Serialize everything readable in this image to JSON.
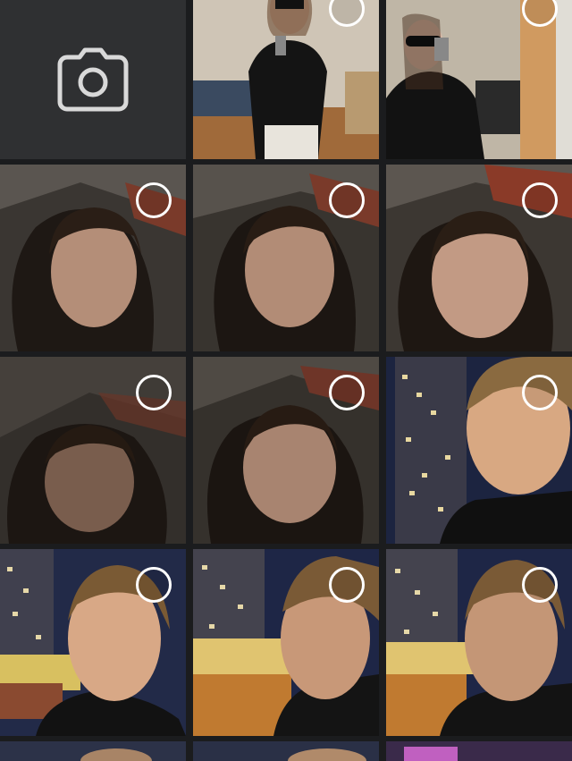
{
  "picker": {
    "camera_tile": {
      "icon": "camera-icon"
    },
    "photos": [
      {
        "id": 1,
        "scene": "mirror-selfie-sunglasses-room",
        "selected": false
      },
      {
        "id": 2,
        "scene": "mirror-selfie-sunglasses-hallway",
        "selected": false
      },
      {
        "id": 3,
        "scene": "night-selfie-graffiti-wall",
        "selected": false
      },
      {
        "id": 4,
        "scene": "night-selfie-graffiti-wall",
        "selected": false
      },
      {
        "id": 5,
        "scene": "night-selfie-graffiti-wall",
        "selected": false
      },
      {
        "id": 6,
        "scene": "night-selfie-blurred",
        "selected": false
      },
      {
        "id": 7,
        "scene": "night-selfie-graffiti-wall",
        "selected": false
      },
      {
        "id": 8,
        "scene": "night-selfie-apartment-building",
        "selected": false
      },
      {
        "id": 9,
        "scene": "night-selfie-building-graffiti",
        "selected": false
      },
      {
        "id": 10,
        "scene": "night-selfie-profile-graffiti",
        "selected": false
      },
      {
        "id": 11,
        "scene": "night-selfie-building-graffiti",
        "selected": false
      }
    ],
    "colors": {
      "background": "#1b1c1e",
      "camera_tile": "#2f3032",
      "selection_ring": "#ffffff"
    }
  }
}
